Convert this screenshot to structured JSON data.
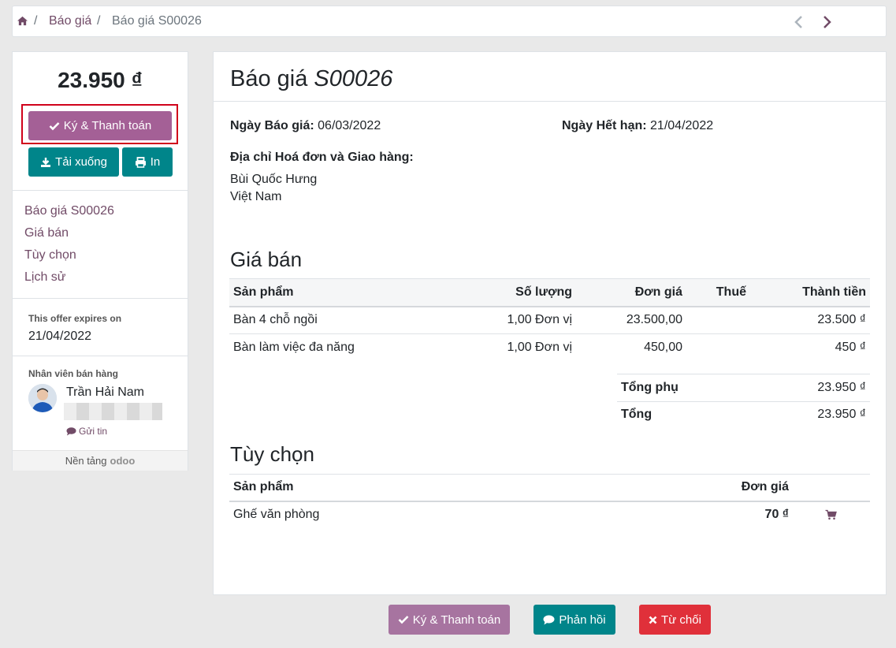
{
  "breadcrumb": {
    "items": [
      "Báo giá",
      "Báo giá S00026"
    ],
    "separator": "/"
  },
  "sidebar": {
    "amount": "23.950 ₫",
    "sign_pay_label": "Ký & Thanh toán",
    "download_label": "Tải xuống",
    "print_label": "In",
    "links": [
      "Báo giá S00026",
      "Giá bán",
      "Tùy chọn",
      "Lịch sử"
    ],
    "expires_label": "This offer expires on",
    "expires_date": "21/04/2022",
    "salesperson_label": "Nhân viên bán hàng",
    "salesperson_name": "Trần Hải Nam",
    "send_message_label": "Gửi tin",
    "powered_by": "Nền tảng",
    "powered_brand": "odoo"
  },
  "main": {
    "title_prefix": "Báo giá",
    "title_ref": "S00026",
    "quote_date_label": "Ngày Báo giá:",
    "quote_date": "06/03/2022",
    "expiry_label": "Ngày Hết hạn:",
    "expiry_date": "21/04/2022",
    "address_label": "Địa chỉ Hoá đơn và Giao hàng:",
    "address_name": "Bùi Quốc Hưng",
    "address_country": "Việt Nam",
    "pricing_title": "Giá bán",
    "pricing_columns": [
      "Sản phẩm",
      "Số lượng",
      "Đơn giá",
      "Thuế",
      "Thành tiền"
    ],
    "pricing_rows": [
      {
        "product": "Bàn 4 chỗ ngồi",
        "qty": "1,00 Đơn vị",
        "unit_price": "23.500,00",
        "tax": "",
        "subtotal": "23.500 ₫"
      },
      {
        "product": "Bàn làm việc đa năng",
        "qty": "1,00 Đơn vị",
        "unit_price": "450,00",
        "tax": "",
        "subtotal": "450 ₫"
      }
    ],
    "subtotal_label": "Tổng phụ",
    "subtotal_value": "23.950 ₫",
    "total_label": "Tổng",
    "total_value": "23.950 ₫",
    "options_title": "Tùy chọn",
    "options_columns": [
      "Sản phẩm",
      "Đơn giá"
    ],
    "options_rows": [
      {
        "product": "Ghế văn phòng",
        "price": "70 ₫"
      }
    ]
  },
  "footer_buttons": {
    "sign_pay": "Ký & Thanh toán",
    "feedback": "Phản hồi",
    "reject": "Từ chối"
  },
  "colors": {
    "brand_purple": "#714b67",
    "button_purple": "#a46096",
    "teal": "#00858a",
    "danger": "#e0303a",
    "highlight_border": "#d0021b"
  }
}
